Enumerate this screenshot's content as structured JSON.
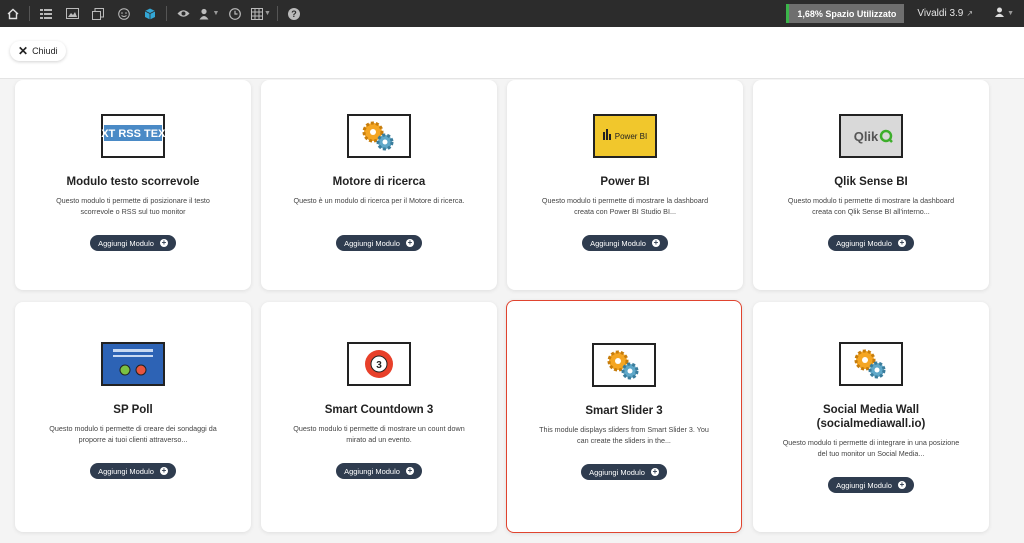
{
  "topbar": {
    "icons": [
      "home-icon",
      "list-icon",
      "image-icon",
      "copy-icon",
      "smiley-icon",
      "cube-icon",
      "eye-icon",
      "user-group-icon",
      "clock-icon",
      "grid-icon",
      "help-icon"
    ],
    "space_label": "1,68% Spazio Utilizzato",
    "space_color": "#3bb54a",
    "version": "Vivaldi 3.9"
  },
  "subheader": {
    "close_label": "Chiudi"
  },
  "modules": [
    {
      "title": "Modulo testo scorrevole",
      "desc": "Questo modulo ti permette di posizionare il testo scorrevole o RSS sul tuo monitor",
      "button": "Aggiungi Modulo",
      "thumb": "rss",
      "thumb_text": "EXT RSS TEXT"
    },
    {
      "title": "Motore di ricerca",
      "desc": "Questo è un modulo di ricerca per il Motore di ricerca.",
      "button": "Aggiungi Modulo",
      "thumb": "gears"
    },
    {
      "title": "Power BI",
      "desc": "Questo modulo ti permette di mostrare la dashboard creata con Power BI Studio BI...",
      "button": "Aggiungi Modulo",
      "thumb": "powerbi",
      "thumb_text": "Power BI"
    },
    {
      "title": "Qlik Sense BI",
      "desc": "Questo modulo ti permette di mostrare la dashboard creata con Qlik Sense BI all'interno...",
      "button": "Aggiungi Modulo",
      "thumb": "qlik",
      "thumb_text": "Qlik"
    },
    {
      "title": "SP Poll",
      "desc": "Questo modulo ti permette di creare dei sondaggi da proporre ai tuoi clienti attraverso...",
      "button": "Aggiungi Modulo",
      "thumb": "poll"
    },
    {
      "title": "Smart Countdown 3",
      "desc": "Questo modulo ti permette di mostrare un count down mirato ad un evento.",
      "button": "Aggiungi Modulo",
      "thumb": "countdown",
      "thumb_text": "3"
    },
    {
      "title": "Smart Slider 3",
      "desc": "This module displays sliders from Smart Slider 3. You can create the sliders in the...",
      "button": "Aggiungi Modulo",
      "thumb": "gears",
      "selected": true
    },
    {
      "title": "Social Media Wall (socialmediawall.io)",
      "desc": "Questo modulo ti permette di integrare in una posizione del tuo monitor un Social Media...",
      "button": "Aggiungi Modulo",
      "thumb": "gears"
    }
  ]
}
